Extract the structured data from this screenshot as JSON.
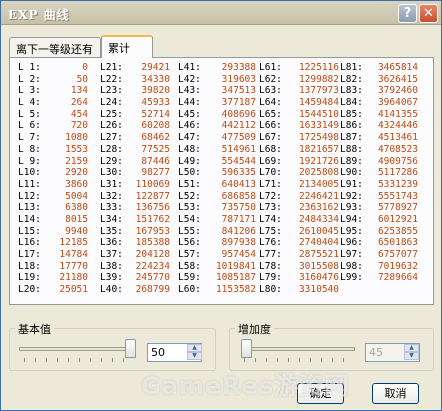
{
  "window": {
    "title": "EXP 曲线",
    "help": "?",
    "close": "✕"
  },
  "tabs": [
    {
      "label": "离下一等级还有"
    },
    {
      "label": "累计"
    }
  ],
  "table": {
    "columns": [
      [
        [
          "L 1:",
          "0"
        ],
        [
          "L 2:",
          "50"
        ],
        [
          "L 3:",
          "134"
        ],
        [
          "L 4:",
          "264"
        ],
        [
          "L 5:",
          "454"
        ],
        [
          "L 6:",
          "720"
        ],
        [
          "L 7:",
          "1080"
        ],
        [
          "L 8:",
          "1553"
        ],
        [
          "L 9:",
          "2159"
        ],
        [
          "L10:",
          "2920"
        ],
        [
          "L11:",
          "3860"
        ],
        [
          "L12:",
          "5004"
        ],
        [
          "L13:",
          "6380"
        ],
        [
          "L14:",
          "8015"
        ],
        [
          "L15:",
          "9940"
        ],
        [
          "L16:",
          "12185"
        ],
        [
          "L17:",
          "14784"
        ],
        [
          "L18:",
          "17770"
        ],
        [
          "L19:",
          "21180"
        ],
        [
          "L20:",
          "25051"
        ]
      ],
      [
        [
          "L21:",
          "29421"
        ],
        [
          "L22:",
          "34330"
        ],
        [
          "L23:",
          "39820"
        ],
        [
          "L24:",
          "45933"
        ],
        [
          "L25:",
          "52714"
        ],
        [
          "L26:",
          "60208"
        ],
        [
          "L27:",
          "68462"
        ],
        [
          "L28:",
          "77525"
        ],
        [
          "L29:",
          "87446"
        ],
        [
          "L30:",
          "98277"
        ],
        [
          "L31:",
          "110069"
        ],
        [
          "L32:",
          "122877"
        ],
        [
          "L33:",
          "136756"
        ],
        [
          "L34:",
          "151762"
        ],
        [
          "L35:",
          "167953"
        ],
        [
          "L36:",
          "185388"
        ],
        [
          "L37:",
          "204128"
        ],
        [
          "L38:",
          "224234"
        ],
        [
          "L39:",
          "245770"
        ],
        [
          "L40:",
          "268799"
        ]
      ],
      [
        [
          "L41:",
          "293388"
        ],
        [
          "L42:",
          "319603"
        ],
        [
          "L43:",
          "347513"
        ],
        [
          "L44:",
          "377187"
        ],
        [
          "L45:",
          "408696"
        ],
        [
          "L46:",
          "442112"
        ],
        [
          "L47:",
          "477509"
        ],
        [
          "L48:",
          "514961"
        ],
        [
          "L49:",
          "554544"
        ],
        [
          "L50:",
          "596335"
        ],
        [
          "L51:",
          "640413"
        ],
        [
          "L52:",
          "686858"
        ],
        [
          "L53:",
          "735750"
        ],
        [
          "L54:",
          "787171"
        ],
        [
          "L55:",
          "841206"
        ],
        [
          "L56:",
          "897938"
        ],
        [
          "L57:",
          "957454"
        ],
        [
          "L58:",
          "1019841"
        ],
        [
          "L59:",
          "1085187"
        ],
        [
          "L60:",
          "1153582"
        ]
      ],
      [
        [
          "L61:",
          "1225116"
        ],
        [
          "L62:",
          "1299882"
        ],
        [
          "L63:",
          "1377973"
        ],
        [
          "L64:",
          "1459484"
        ],
        [
          "L65:",
          "1544510"
        ],
        [
          "L66:",
          "1633149"
        ],
        [
          "L67:",
          "1725498"
        ],
        [
          "L68:",
          "1821657"
        ],
        [
          "L69:",
          "1921726"
        ],
        [
          "L70:",
          "2025808"
        ],
        [
          "L71:",
          "2134005"
        ],
        [
          "L72:",
          "2246421"
        ],
        [
          "L73:",
          "2363162"
        ],
        [
          "L74:",
          "2484334"
        ],
        [
          "L75:",
          "2610045"
        ],
        [
          "L76:",
          "2740404"
        ],
        [
          "L77:",
          "2875521"
        ],
        [
          "L78:",
          "3015508"
        ],
        [
          "L79:",
          "3160476"
        ],
        [
          "L80:",
          "3310540"
        ]
      ],
      [
        [
          "L81:",
          "3465814"
        ],
        [
          "L82:",
          "3626415"
        ],
        [
          "L83:",
          "3792460"
        ],
        [
          "L84:",
          "3964067"
        ],
        [
          "L85:",
          "4141355"
        ],
        [
          "L86:",
          "4324446"
        ],
        [
          "L87:",
          "4513461"
        ],
        [
          "L88:",
          "4708523"
        ],
        [
          "L89:",
          "4909756"
        ],
        [
          "L90:",
          "5117286"
        ],
        [
          "L91:",
          "5331239"
        ],
        [
          "L92:",
          "5551743"
        ],
        [
          "L93:",
          "5778927"
        ],
        [
          "L94:",
          "6012921"
        ],
        [
          "L95:",
          "6253855"
        ],
        [
          "L96:",
          "6501863"
        ],
        [
          "L97:",
          "6757077"
        ],
        [
          "L98:",
          "7019632"
        ],
        [
          "L99:",
          "7289664"
        ]
      ]
    ],
    "label_color": "#000000",
    "value_color": "#c04a12"
  },
  "base": {
    "label": "基本值",
    "value": "50",
    "level": 1.0
  },
  "increase": {
    "label": "增加度",
    "value": "45",
    "level": 0.0
  },
  "buttons": {
    "ok": "确定",
    "cancel": "取消"
  },
  "watermark": "GameRes游资网"
}
